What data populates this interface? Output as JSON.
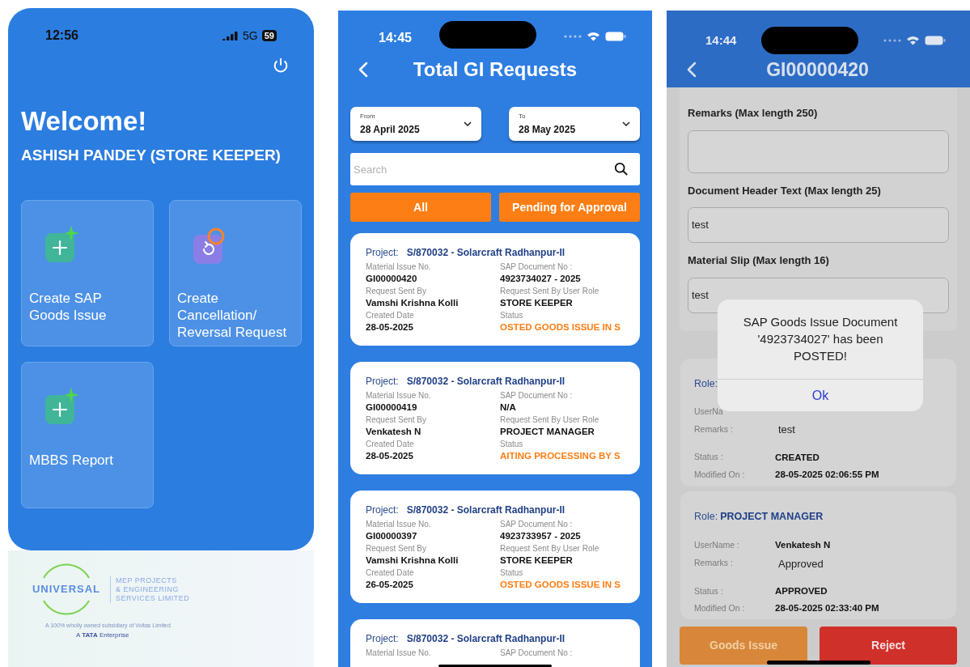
{
  "home": {
    "status_bar": {
      "time": "12:56",
      "network": "5G",
      "battery": "59"
    },
    "title": "Welcome!",
    "user": "ASHISH PANDEY (STORE KEEPER)",
    "tiles": [
      {
        "kind": "add",
        "label": "Create SAP Goods Issue"
      },
      {
        "kind": "reverse",
        "label": "Create Cancellation/ Reversal Request"
      },
      {
        "kind": "add",
        "label": "MBBS Report"
      }
    ],
    "footer": {
      "logo_word": "UNIVERSAL",
      "company": [
        "MEP PROJECTS",
        "& ENGINEERING",
        "SERVICES LIMITED"
      ],
      "subsidiary": "A 100% wholly owned subsidiary of Voltas Limited",
      "enterprise": "A **TATA** Enterprise"
    }
  },
  "requests": {
    "status_bar": {
      "time": "14:45"
    },
    "title": "Total GI Requests",
    "dates": [
      {
        "label": "From",
        "value": "28 April 2025"
      },
      {
        "label": "To",
        "value": "28 May 2025"
      }
    ],
    "search": {
      "placeholder": "Search"
    },
    "filters": [
      "All",
      "Pending for Approval"
    ],
    "cards": [
      {
        "project_label": "Project:",
        "project": "S/870032 - Solarcraft Radhanpur-II",
        "fields": [
          {
            "label": "Material Issue No.",
            "value": "GI00000420",
            "kind": "plain"
          },
          {
            "label": "SAP Document No :",
            "value": "4923734027 - 2025",
            "kind": "plain"
          },
          {
            "label": "Request Sent By",
            "value": "Vamshi Krishna Kolli",
            "kind": "plain"
          },
          {
            "label": "Request Sent By User Role",
            "value": "STORE KEEPER",
            "kind": "plain"
          },
          {
            "label": "Created Date",
            "value": "28-05-2025",
            "kind": "plain"
          },
          {
            "label": "Status",
            "value": "OSTED GOODS ISSUE IN S",
            "kind": "status"
          }
        ]
      },
      {
        "project_label": "Project:",
        "project": "S/870032 - Solarcraft Radhanpur-II",
        "fields": [
          {
            "label": "Material Issue No.",
            "value": "GI00000419",
            "kind": "plain"
          },
          {
            "label": "SAP Document No :",
            "value": "N/A",
            "kind": "plain"
          },
          {
            "label": "Request Sent By",
            "value": "Venkatesh N",
            "kind": "plain"
          },
          {
            "label": "Request Sent By User Role",
            "value": "PROJECT MANAGER",
            "kind": "plain"
          },
          {
            "label": "Created Date",
            "value": "28-05-2025",
            "kind": "plain"
          },
          {
            "label": "Status",
            "value": "AITING PROCESSING BY S",
            "kind": "status"
          }
        ]
      },
      {
        "project_label": "Project:",
        "project": "S/870032 - Solarcraft Radhanpur-II",
        "fields": [
          {
            "label": "Material Issue No.",
            "value": "GI00000397",
            "kind": "plain"
          },
          {
            "label": "SAP Document No :",
            "value": "4923733957 - 2025",
            "kind": "plain"
          },
          {
            "label": "Request Sent By",
            "value": "Vamshi Krishna Kolli",
            "kind": "plain"
          },
          {
            "label": "Request Sent By User Role",
            "value": "STORE KEEPER",
            "kind": "plain"
          },
          {
            "label": "Created Date",
            "value": "26-05-2025",
            "kind": "plain"
          },
          {
            "label": "Status",
            "value": "OSTED GOODS ISSUE IN S",
            "kind": "status"
          }
        ]
      },
      {
        "project_label": "Project:",
        "project": "S/870032 - Solarcraft Radhanpur-II",
        "fields": [
          {
            "label": "Material Issue No."
          },
          {
            "label": "SAP Document No :"
          }
        ]
      }
    ]
  },
  "detail": {
    "status_bar": {
      "time": "14:44"
    },
    "title": "GI00000420",
    "form": [
      {
        "label": "Remarks (Max length 250)",
        "kind": "textarea"
      },
      {
        "label": "Document Header Text (Max length 25)",
        "kind": "input",
        "value": "test"
      },
      {
        "label": "Material Slip (Max length 16)",
        "kind": "input",
        "value": "test"
      }
    ],
    "approvals": [
      {
        "role_label": "Role:",
        "fields": [
          {
            "label": "UserNa"
          },
          {
            "label": "Remarks :",
            "value": "test",
            "kind": "note"
          },
          {
            "label": "Status :",
            "value": "CREATED",
            "kind": "value"
          },
          {
            "label": "Modified On :",
            "value": "28-05-2025 02:06:55 PM",
            "kind": "value"
          }
        ]
      },
      {
        "role_label": "Role:",
        "role": "PROJECT MANAGER",
        "fields": [
          {
            "label": "UserName :",
            "value": "Venkatesh N",
            "kind": "value"
          },
          {
            "label": "Remarks :",
            "value": "Approved",
            "kind": "note"
          },
          {
            "label": "Status :",
            "value": "APPROVED",
            "kind": "value"
          },
          {
            "label": "Modified On :",
            "value": "28-05-2025 02:33:40 PM",
            "kind": "value"
          }
        ]
      }
    ],
    "buttons": [
      {
        "kind": "primary",
        "label": "Goods Issue",
        "disabled": true
      },
      {
        "kind": "danger",
        "label": "Reject",
        "disabled": false
      }
    ],
    "dialog": {
      "message": "SAP Goods Issue Document '4923734027' has been POSTED!",
      "button": "Ok"
    }
  }
}
